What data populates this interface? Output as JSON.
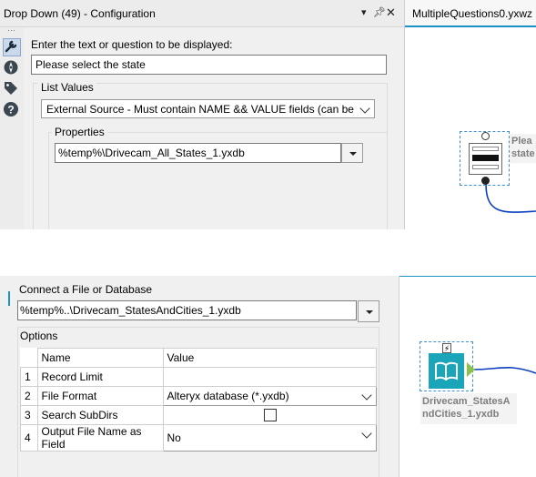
{
  "top_panel": {
    "title": "Drop Down (49) - Configuration",
    "prompt_label": "Enter the text or question to be displayed:",
    "prompt_value": "Please select the state",
    "list_values_label": "List Values",
    "source_value": "External Source - Must contain NAME && VALUE fields  (can be rela",
    "properties_label": "Properties",
    "file_value": "%temp%\\Drivecam_All_States_1.yxdb"
  },
  "workflow_tab": {
    "label": "MultipleQuestions0.yxwz"
  },
  "top_canvas": {
    "tool_label_line1": "Plea",
    "tool_label_line2": "state"
  },
  "bottom_panel": {
    "connect_label": "Connect a File or Database",
    "file_value": "%temp%..\\Drivecam_StatesAndCities_1.yxdb",
    "options_label": "Options",
    "columns": [
      "Name",
      "Value"
    ],
    "rows": [
      {
        "num": "1",
        "name": "Record Limit",
        "value": ""
      },
      {
        "num": "2",
        "name": "File Format",
        "value": "Alteryx database (*.yxdb)"
      },
      {
        "num": "3",
        "name": "Search SubDirs",
        "value": ""
      },
      {
        "num": "4",
        "name": "Output File Name as Field",
        "value": "No"
      }
    ]
  },
  "bottom_canvas": {
    "tool_label": "Drivecam_StatesAndCities_1.yxdb",
    "tool_label_line1": "Drivecam_StatesA",
    "tool_label_line2": "ndCities_1.yxdb"
  },
  "icons": [
    "wrench-icon",
    "compass-icon",
    "tag-icon",
    "help-icon",
    "lightning-icon",
    "book-icon"
  ],
  "colors": {
    "accent": "#1e90c8",
    "connector": "#0a3fc0",
    "input_tool": "#1aa5b8",
    "output_anchor": "#8bc34a"
  }
}
